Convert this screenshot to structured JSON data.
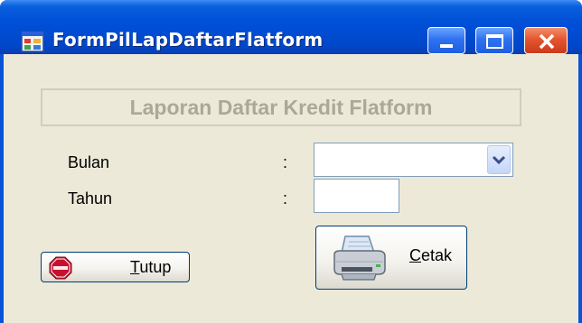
{
  "window": {
    "title": "FormPilLapDaftarFlatform",
    "controls": {
      "minimize": "minimize-icon",
      "maximize": "maximize-icon",
      "close": "close-icon"
    }
  },
  "form": {
    "header": "Laporan Daftar Kredit Flatform",
    "fields": [
      {
        "label": "Bulan",
        "separator": ":",
        "value": ""
      },
      {
        "label": "Tahun",
        "separator": ":",
        "value": ""
      }
    ]
  },
  "buttons": {
    "tutup": {
      "mnemonic": "T",
      "rest": "utup",
      "icon": "stop-sign-icon"
    },
    "cetak": {
      "mnemonic": "C",
      "rest": "etak",
      "icon": "printer-icon"
    }
  },
  "colors": {
    "titlebar": "#0050d8",
    "client_bg": "#ece9d8",
    "close_button": "#e4552f",
    "disabled_text": "#aca899"
  }
}
